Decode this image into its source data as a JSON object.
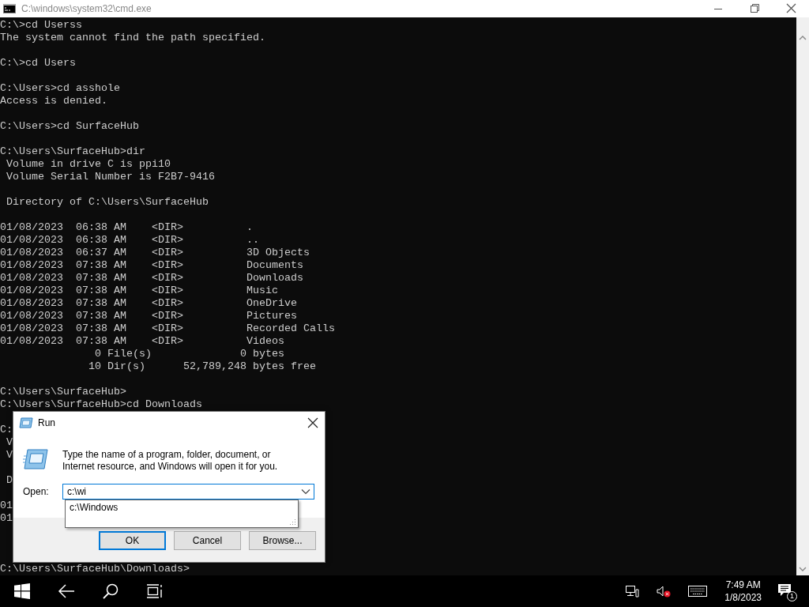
{
  "window": {
    "title": "C:\\windows\\system32\\cmd.exe"
  },
  "console": {
    "blocks": [
      [
        "C:\\>cd Userss",
        "The system cannot find the path specified."
      ],
      [
        "C:\\>cd Users"
      ],
      [
        "C:\\Users>cd asshole",
        "Access is denied."
      ],
      [
        "C:\\Users>cd SurfaceHub"
      ],
      [
        "C:\\Users\\SurfaceHub>dir",
        " Volume in drive C is ppi10",
        " Volume Serial Number is F2B7-9416"
      ],
      [
        " Directory of C:\\Users\\SurfaceHub"
      ],
      [
        "01/08/2023  06:38 AM    <DIR>          .",
        "01/08/2023  06:38 AM    <DIR>          ..",
        "01/08/2023  06:37 AM    <DIR>          3D Objects",
        "01/08/2023  07:38 AM    <DIR>          Documents",
        "01/08/2023  07:38 AM    <DIR>          Downloads",
        "01/08/2023  07:38 AM    <DIR>          Music",
        "01/08/2023  07:38 AM    <DIR>          OneDrive",
        "01/08/2023  07:38 AM    <DIR>          Pictures",
        "01/08/2023  07:38 AM    <DIR>          Recorded Calls",
        "01/08/2023  07:38 AM    <DIR>          Videos",
        "               0 File(s)              0 bytes",
        "              10 Dir(s)      52,789,248 bytes free"
      ],
      [
        "C:\\Users\\SurfaceHub>",
        "C:\\Users\\SurfaceHub>cd Downloads"
      ],
      [
        "C:",
        " V",
        " V"
      ],
      [
        " D"
      ],
      [
        "01",
        "01"
      ]
    ],
    "prompt": "C:\\Users\\SurfaceHub\\Downloads>"
  },
  "run_dialog": {
    "title": "Run",
    "description": "Type the name of a program, folder, document, or Internet resource, and Windows will open it for you.",
    "open_label": "Open:",
    "open_value": "c:\\wi",
    "suggestions": [
      "c:\\Windows"
    ],
    "buttons": [
      {
        "label": "OK",
        "default": true
      },
      {
        "label": "Cancel",
        "default": false
      },
      {
        "label": "Browse...",
        "default": false
      }
    ]
  },
  "taskbar": {
    "volume_muted": true,
    "clock_time": "7:49 AM",
    "clock_date": "1/8/2023",
    "notification_count": "1"
  }
}
